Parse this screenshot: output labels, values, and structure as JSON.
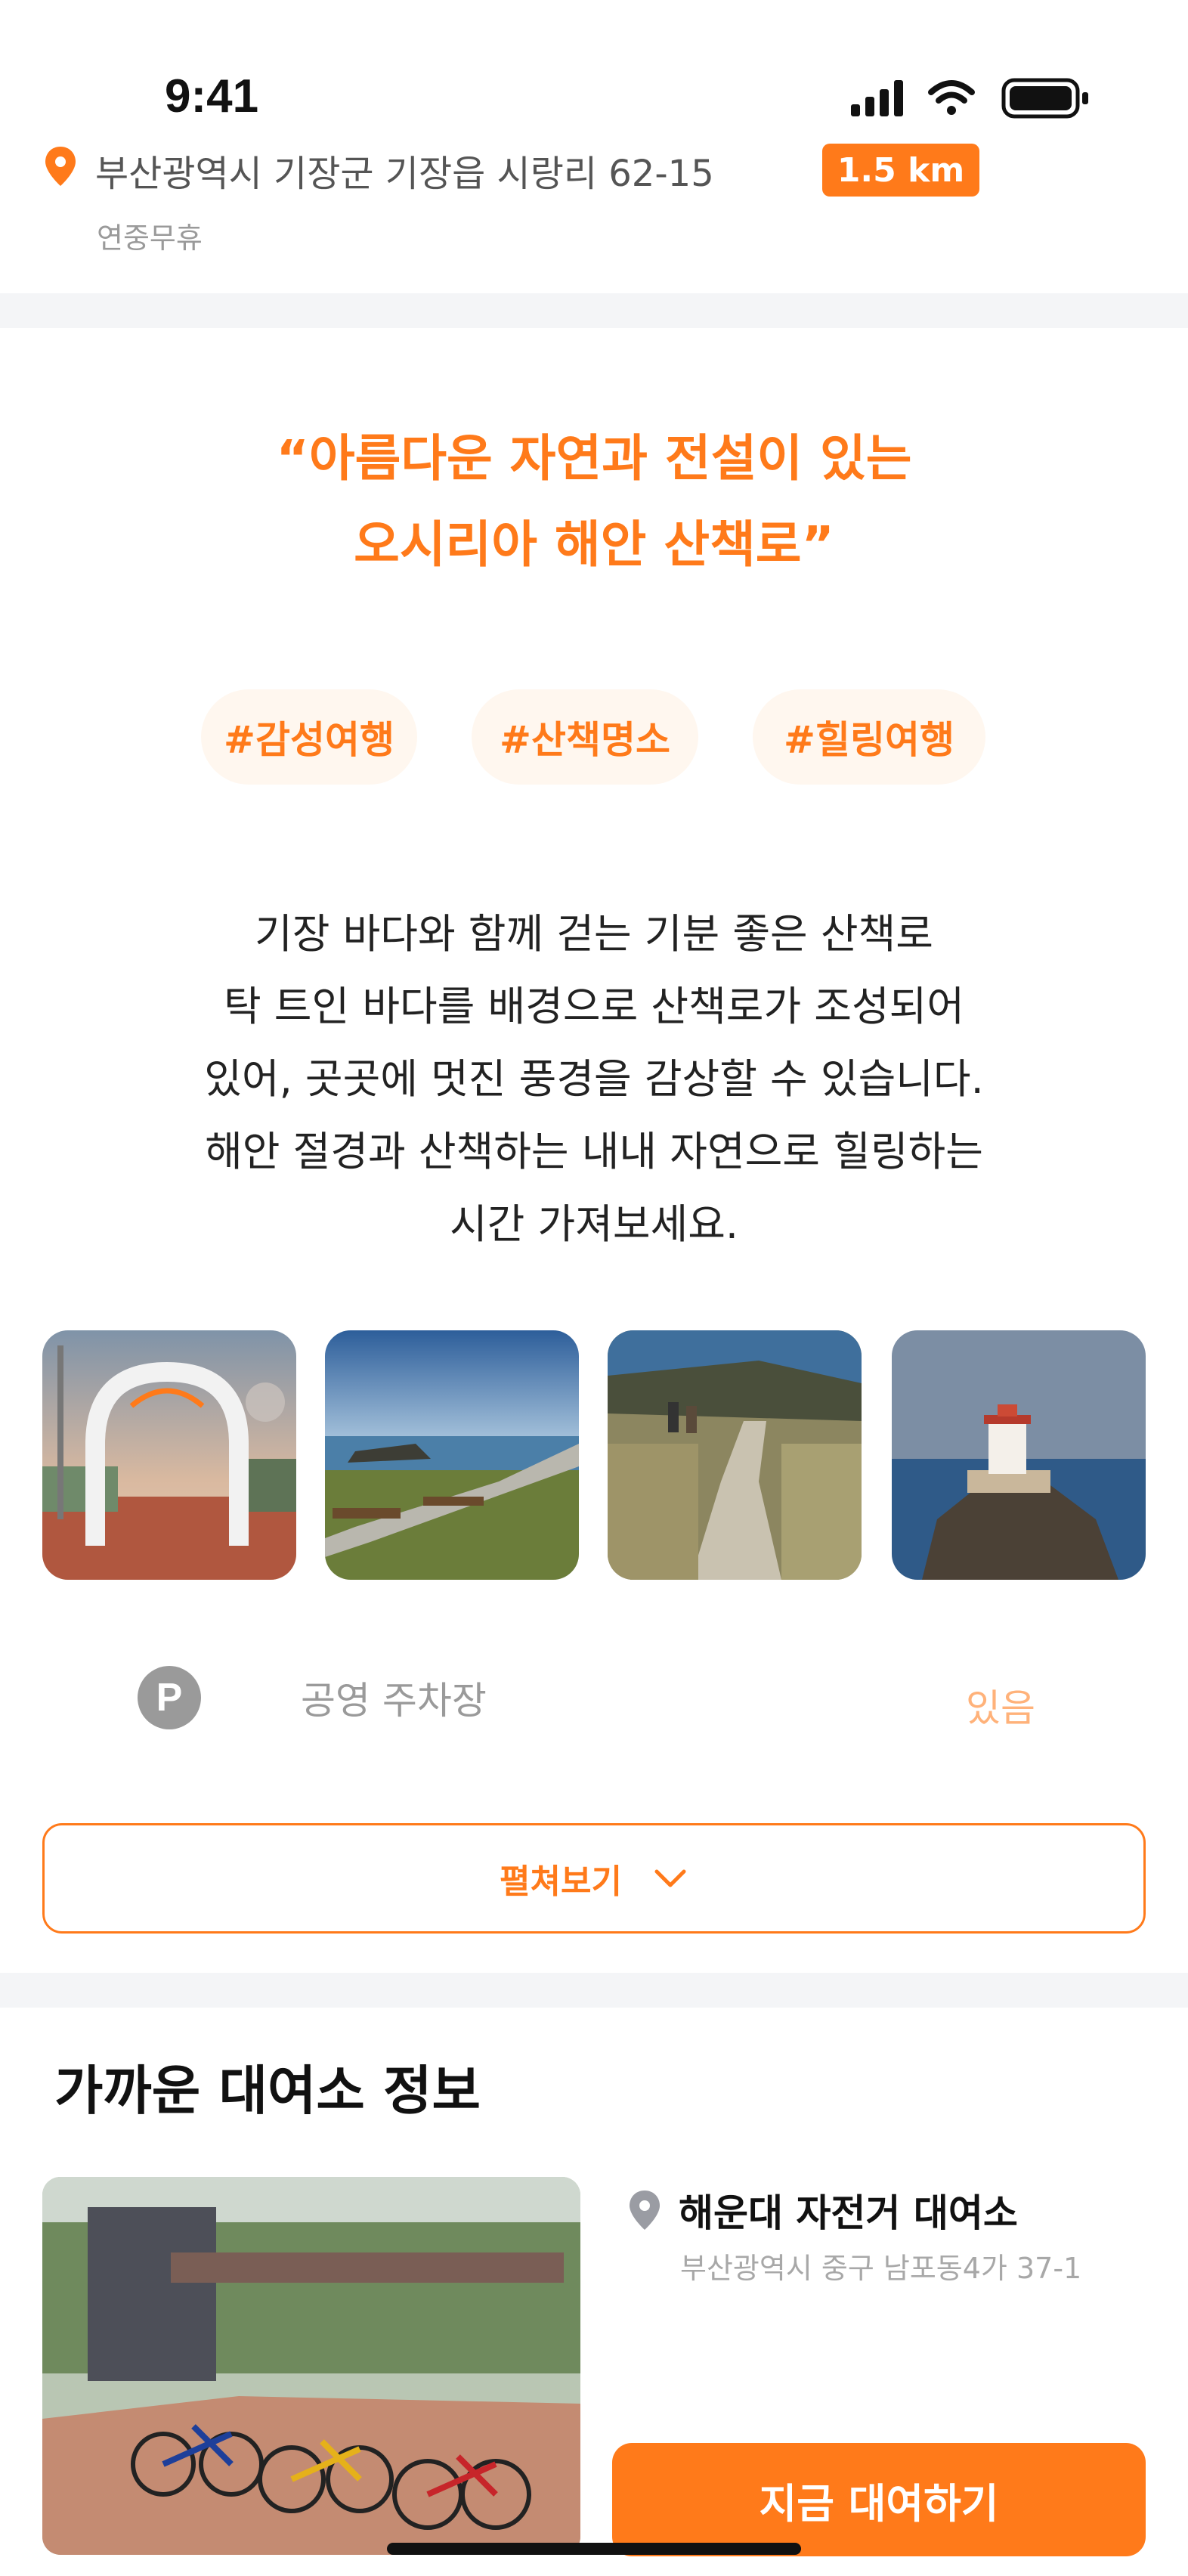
{
  "status_bar": {
    "time": "9:41"
  },
  "place": {
    "address": "부산광역시 기장군 기장읍 시랑리 62-15",
    "distance": "1.5 km",
    "holiday": "연중무휴"
  },
  "intro": {
    "quote_line1": "“아름다운 자연과 전설이 있는",
    "quote_line2": "오시리아 해안 산책로”",
    "tags": [
      "#감성여행",
      "#산책명소",
      "#힐링여행"
    ],
    "description": [
      "기장 바다와 함께 걷는 기분 좋은 산책로",
      "탁 트인 바다를 배경으로 산책로가 조성되어",
      "있어, 곳곳에 멋진 풍경을 감상할 수 있습니다.",
      "해안 절경과 산책하는 내내 자연으로 힐링하는",
      "시간 가져보세요."
    ]
  },
  "parking": {
    "icon_letter": "P",
    "label": "공영 주차장",
    "value": "있음"
  },
  "expand_button": {
    "label": "펼쳐보기"
  },
  "rental": {
    "section_title": "가까운 대여소 정보",
    "name": "해운대 자전거 대여소",
    "address": "부산광역시 중구 남포동4가 37-1",
    "button_label": "지금 대여하기"
  },
  "colors": {
    "accent": "#ff7a1a",
    "tag_background": "#fff7ef",
    "divider": "#f4f5f7"
  }
}
